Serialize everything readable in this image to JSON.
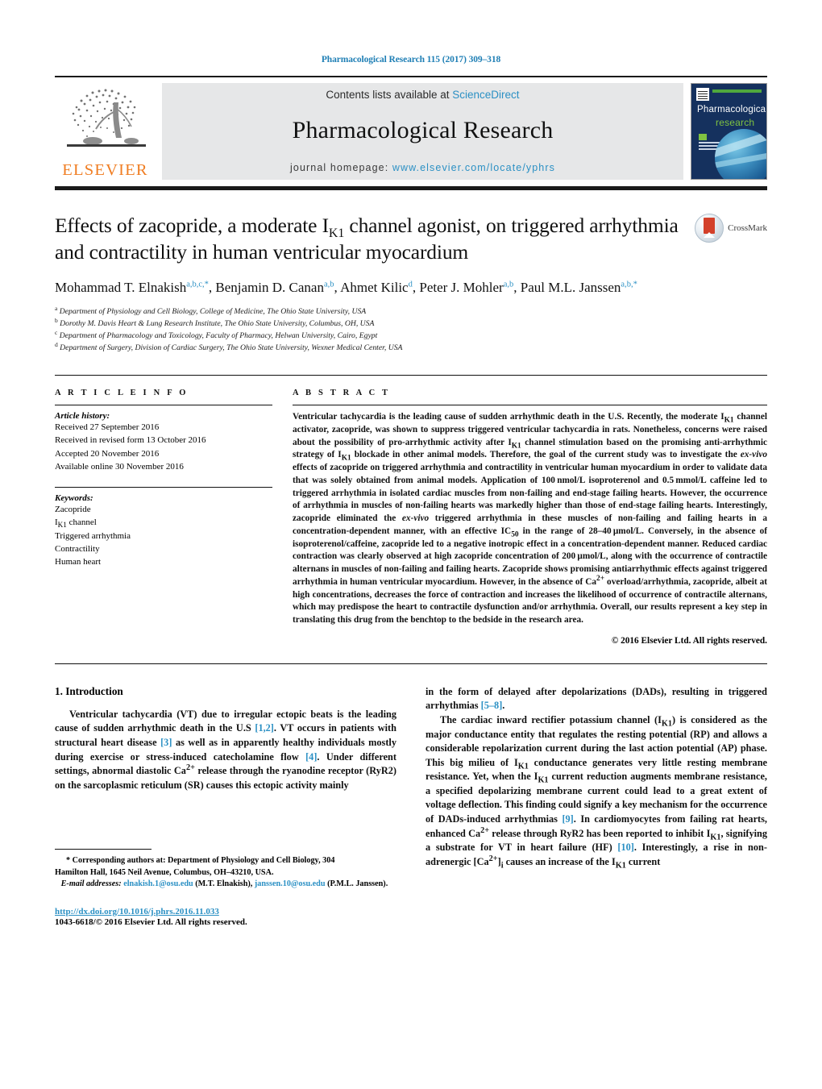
{
  "running_head": "Pharmacological Research 115 (2017) 309–318",
  "masthead": {
    "contents_prefix": "Contents lists available at",
    "sciencedirect": "ScienceDirect",
    "journal_title": "Pharmacological Research",
    "homepage_prefix": "journal homepage:",
    "homepage_url": "www.elsevier.com/locate/yphrs",
    "publisher_wordmark": "ELSEVIER",
    "cover": {
      "line1": "Pharmacological",
      "line2": "research"
    },
    "accent_blue": "#2b90c4",
    "elsevier_orange": "#f07d22",
    "cover_navy": "#15315e",
    "cover_green": "#4fa83d"
  },
  "crossmark": {
    "label": "CrossMark"
  },
  "article": {
    "title_line1_a": "Effects of zacopride, a moderate I",
    "title_line1_sub": "K1",
    "title_line1_b": " channel agonist, on triggered",
    "title_line2": "arrhythmia and contractility in human ventricular myocardium",
    "authors_html": "Mohammad T. Elnakish<sup>a,b,c,</sup><sup>*</sup>, Benjamin D. Canan<sup>a,b</sup>, Ahmet Kilic<sup>d</sup>, Peter J. Mohler<sup>a,b</sup>, Paul M.L. Janssen<sup>a,b,</sup><sup>*</sup>",
    "affiliations": [
      {
        "mark": "a",
        "text": "Department of Physiology and Cell Biology, College of Medicine, The Ohio State University, USA"
      },
      {
        "mark": "b",
        "text": "Dorothy M. Davis Heart & Lung Research Institute, The Ohio State University, Columbus, OH, USA"
      },
      {
        "mark": "c",
        "text": "Department of Pharmacology and Toxicology, Faculty of Pharmacy, Helwan University, Cairo, Egypt"
      },
      {
        "mark": "d",
        "text": "Department of Surgery, Division of Cardiac Surgery, The Ohio State University, Wexner Medical Center, USA"
      }
    ]
  },
  "article_info": {
    "heading": "A R T I C L E   I N F O",
    "history_label": "Article history:",
    "history": [
      "Received 27 September 2016",
      "Received in revised form 13 October 2016",
      "Accepted 20 November 2016",
      "Available online 30 November 2016"
    ],
    "keywords_label": "Keywords:",
    "keywords": [
      "Zacopride",
      "IK1 channel",
      "Triggered arrhythmia",
      "Contractility",
      "Human heart"
    ]
  },
  "abstract": {
    "heading": "A B S T R A C T",
    "text_html": "Ventricular tachycardia is the leading cause of sudden arrhythmic death in the U.S. Recently, the moderate I<sub>K1</sub> channel activator, zacopride, was shown to suppress triggered ventricular tachycardia in rats. Nonetheless, concerns were raised about the possibility of pro-arrhythmic activity after I<sub>K1</sub> channel stimulation based on the promising anti-arrhythmic strategy of I<sub>K1</sub> blockade in other animal models. Therefore, the goal of the current study was to investigate the <em>ex-vivo</em> effects of zacopride on triggered arrhythmia and contractility in ventricular human myocardium in order to validate data that was solely obtained from animal models. Application of 100&#8239;nmol/L isoproterenol and 0.5&#8239;mmol/L caffeine led to triggered arrhythmia in isolated cardiac muscles from non-failing and end-stage failing hearts. However, the occurrence of arrhythmia in muscles of non-failing hearts was markedly higher than those of end-stage failing hearts. Interestingly, zacopride eliminated the <em>ex-vivo</em> triggered arrhythmia in these muscles of non-failing and failing hearts in a concentration-dependent manner, with an effective IC<sub>50</sub> in the range of 28&#8211;40&#8239;&#956;mol/L. Conversely, in the absence of isoproterenol/caffeine, zacopride led to a negative inotropic effect in a concentration-dependent manner. Reduced cardiac contraction was clearly observed at high zacopride concentration of 200&#8239;&#956;mol/L, along with the occurrence of contractile alternans in muscles of non-failing and failing hearts. Zacopride shows promising antiarrhythmic effects against triggered arrhythmia in human ventricular myocardium. However, in the absence of Ca<sup>2+</sup> overload/arrhythmia, zacopride, albeit at high concentrations, decreases the force of contraction and increases the likelihood of occurrence of contractile alternans, which may predispose the heart to contractile dysfunction and/or arrhythmia. Overall, our results represent a key step in translating this drug from the benchtop to the bedside in the research area.",
    "copyright": "© 2016 Elsevier Ltd. All rights reserved."
  },
  "introduction": {
    "heading": "1.  Introduction",
    "left_html": "Ventricular tachycardia (VT) due to irregular ectopic beats is the leading cause of sudden arrhythmic death in the U.S <span class=\"ref\">[1,2]</span>. VT occurs in patients with structural heart disease <span class=\"ref\">[3]</span> as well as in apparently healthy individuals mostly during exercise or stress-induced catecholamine flow <span class=\"ref\">[4]</span>. Under different settings, abnormal diastolic Ca<sup>2+</sup> release through the ryanodine receptor (RyR2) on the sarcoplasmic reticulum (SR) causes this ectopic activity mainly",
    "right_html_1": "in the form of delayed after depolarizations (DADs), resulting in triggered arrhythmias <span class=\"ref\">[5&#8211;8]</span>.",
    "right_html_2": "The cardiac inward rectifier potassium channel (I<sub>K1</sub>) is considered as the major conductance entity that regulates the resting potential (RP) and allows a considerable repolarization current during the last action potential (AP) phase. This big milieu of I<sub>K1</sub> conductance generates very little resting membrane resistance. Yet, when the I<sub>K1</sub> current reduction augments membrane resistance, a specified depolarizing membrane current could lead to a great extent of voltage deflection. This finding could signify a key mechanism for the occurrence of DADs-induced arrhythmias <span class=\"ref\">[9]</span>. In cardiomyocytes from failing rat hearts, enhanced Ca<sup>2+</sup> release through RyR2 has been reported to inhibit I<sub>K1</sub>, signifying a substrate for VT in heart failure (HF) <span class=\"ref\">[10]</span>. Interestingly, a rise in non-adrenergic [Ca<sup>2+</sup>]<sub>i</sub> causes an increase of the I<sub>K1</sub> current"
  },
  "footnotes": {
    "corresponding_html": "<span class=\"ind\">* Corresponding authors at: Department of Physiology and Cell Biology, 304</span>Hamilton Hall, 1645 Neil Avenue, Columbus, OH&#8211;43210, USA.",
    "email_label": "E-mail addresses:",
    "email_1": "elnakish.1@osu.edu",
    "email_1_owner": "(M.T. Elnakish),",
    "email_2": "janssen.10@osu.edu",
    "email_2_owner": "(P.M.L. Janssen).",
    "doi": "http://dx.doi.org/10.1016/j.phrs.2016.11.033",
    "issn_line": "1043-6618/© 2016 Elsevier Ltd. All rights reserved."
  }
}
